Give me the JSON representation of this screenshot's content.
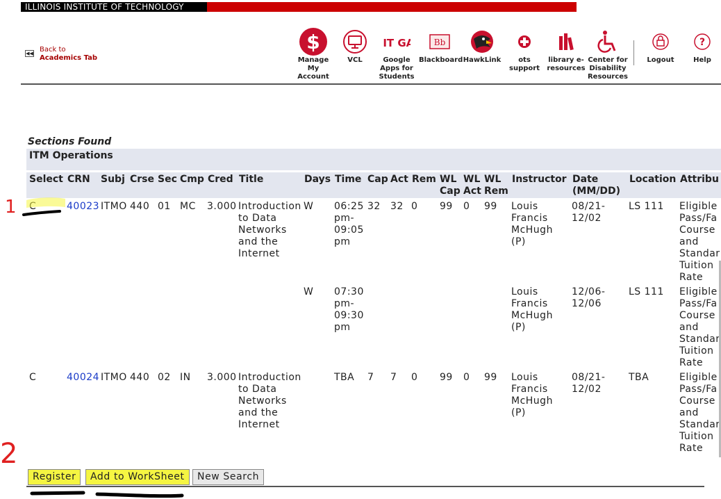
{
  "banner": {
    "institution": "ILLINOIS INSTITUTE OF TECHNOLOGY"
  },
  "back_link": {
    "line1": "Back to",
    "line2": "Academics Tab"
  },
  "toolbar": {
    "manage": "Manage My Account",
    "vcl": "VCL",
    "google": "Google Apps for Students",
    "google_logo": "IIT GA",
    "blackboard": "Blackboard",
    "blackboard_logo": "Bb",
    "hawklink": "HawkLink",
    "ots": "ots support",
    "library": "library e-resources",
    "disability": "Center for Disability Resources",
    "logout": "Logout",
    "help": "Help"
  },
  "page": {
    "heading": "Sections Found",
    "group": "ITM Operations"
  },
  "table": {
    "headers": {
      "select": "Select",
      "crn": "CRN",
      "subj": "Subj",
      "crse": "Crse",
      "sec": "Sec",
      "cmp": "Cmp",
      "cred": "Cred",
      "title": "Title",
      "days": "Days",
      "time": "Time",
      "cap": "Cap",
      "act": "Act",
      "rem": "Rem",
      "wlcap": "WL Cap",
      "wlact": "WL Act",
      "wlrem": "WL Rem",
      "instructor": "Instructor",
      "date": "Date (MM/DD)",
      "location": "Location",
      "attrib": "Attribu"
    },
    "rows": [
      {
        "select": "C",
        "crn": "40023",
        "subj": "ITMO",
        "crse": "440",
        "sec": "01",
        "cmp": "MC",
        "cred": "3.000",
        "title": "Introduction to Data Networks and the Internet",
        "days": "W",
        "time": "06:25 pm-09:05 pm",
        "cap": "32",
        "act": "32",
        "rem": "0",
        "wlcap": "99",
        "wlact": "0",
        "wlrem": "99",
        "instructor": "Louis Francis McHugh (P)",
        "date": "08/21-12/02",
        "location": "LS 111",
        "attrib": "Eligible Pass/Fa Course and Standar Tuition Rate"
      },
      {
        "days": "W",
        "time": "07:30 pm-09:30 pm",
        "instructor": "Louis Francis McHugh (P)",
        "date": "12/06-12/06",
        "location": "LS 111",
        "attrib": "Eligible Pass/Fa Course and Standar Tuition Rate"
      },
      {
        "select": "C",
        "crn": "40024",
        "subj": "ITMO",
        "crse": "440",
        "sec": "02",
        "cmp": "IN",
        "cred": "3.000",
        "title": "Introduction to Data Networks and the Internet",
        "days": "",
        "time": "TBA",
        "cap": "7",
        "act": "7",
        "rem": "0",
        "wlcap": "99",
        "wlact": "0",
        "wlrem": "99",
        "instructor": "Louis Francis McHugh (P)",
        "date": "08/21-12/02",
        "location": "TBA",
        "attrib": "Eligible Pass/Fa Course and Standar Tuition Rate"
      }
    ]
  },
  "buttons": {
    "register": "Register",
    "worksheet": "Add to WorkSheet",
    "new_search": "New Search"
  },
  "annotations": {
    "step1": "1",
    "step2": "2"
  },
  "colors": {
    "brand_red": "#cc0000",
    "header_bg": "#e3e6ef",
    "link_blue": "#1a3bc8",
    "highlight": "#f5f542"
  }
}
